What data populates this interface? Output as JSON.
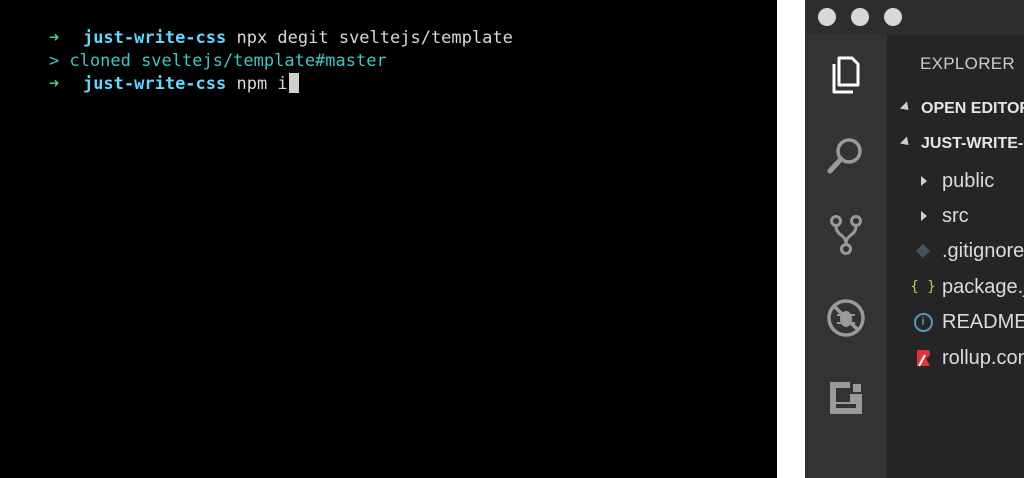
{
  "terminal": {
    "prompt_symbol": "➜",
    "lines": [
      {
        "dir": "just-write-css",
        "command": " npx degit sveltejs/template"
      },
      {
        "output": "> cloned sveltejs/template#master"
      },
      {
        "dir": "just-write-css",
        "command": " npm i"
      }
    ]
  },
  "editor": {
    "explorer_title": "EXPLORER",
    "sections": {
      "open_editors": "OPEN EDITORS",
      "workspace": "JUST-WRITE-CSS"
    },
    "tree": [
      {
        "name": "public",
        "type": "folder"
      },
      {
        "name": "src",
        "type": "folder"
      },
      {
        "name": ".gitignore",
        "type": "file",
        "icon": "git-icon"
      },
      {
        "name": "package.json",
        "type": "file",
        "icon": "json-icon"
      },
      {
        "name": "README.md",
        "type": "file",
        "icon": "info-icon"
      },
      {
        "name": "rollup.config.js",
        "type": "file",
        "icon": "rollup-icon"
      }
    ],
    "icon_glyphs": {
      "json": "{ }",
      "info": "i"
    },
    "colors": {
      "json": "#cbcb41",
      "info": "#519aba",
      "rollup": "#e0343c",
      "git": "#41535b"
    }
  }
}
